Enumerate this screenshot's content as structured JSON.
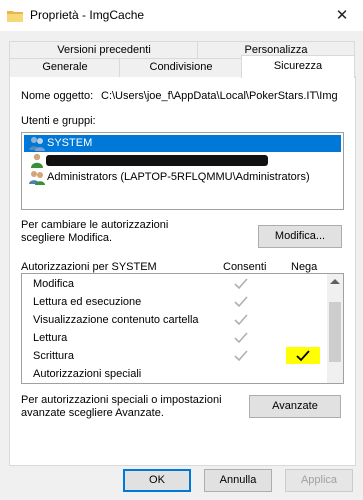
{
  "window": {
    "title": "Proprietà - ImgCache"
  },
  "tabs": {
    "row1": [
      {
        "label": "Versioni precedenti"
      },
      {
        "label": "Personalizza"
      }
    ],
    "row2": [
      {
        "label": "Generale"
      },
      {
        "label": "Condivisione"
      },
      {
        "label": "Sicurezza"
      }
    ]
  },
  "object": {
    "label": "Nome oggetto:",
    "path": "C:\\Users\\joe_f\\AppData\\Local\\PokerStars.IT\\Img"
  },
  "users": {
    "label": "Utenti e gruppi:",
    "items": [
      {
        "name": "SYSTEM",
        "selected": true
      },
      {
        "name": "",
        "redacted": true
      },
      {
        "name": "Administrators (LAPTOP-5RFLQMMU\\Administrators)"
      }
    ]
  },
  "change": {
    "text_line1": "Per cambiare le autorizzazioni",
    "text_line2": "scegliere Modifica.",
    "button": "Modifica..."
  },
  "permissions": {
    "label": "Autorizzazioni per SYSTEM",
    "allow_header": "Consenti",
    "deny_header": "Nega",
    "items": [
      {
        "name": "Modifica",
        "allow": "gray",
        "deny": ""
      },
      {
        "name": "Lettura ed esecuzione",
        "allow": "gray",
        "deny": ""
      },
      {
        "name": "Visualizzazione contenuto cartella",
        "allow": "gray",
        "deny": ""
      },
      {
        "name": "Lettura",
        "allow": "gray",
        "deny": ""
      },
      {
        "name": "Scrittura",
        "allow": "gray",
        "deny": "highlighted"
      },
      {
        "name": "Autorizzazioni speciali",
        "allow": "",
        "deny": ""
      }
    ]
  },
  "advanced": {
    "text_line1": "Per autorizzazioni speciali o impostazioni",
    "text_line2": "avanzate scegliere Avanzate.",
    "button": "Avanzate"
  },
  "footer": {
    "ok": "OK",
    "cancel": "Annulla",
    "apply": "Applica"
  },
  "icons": {
    "close": "close-icon",
    "folder": "folder-icon",
    "user": "user-icon",
    "check": "check-icon"
  },
  "colors": {
    "selection": "#0078d7",
    "highlight": "#ffff00"
  }
}
